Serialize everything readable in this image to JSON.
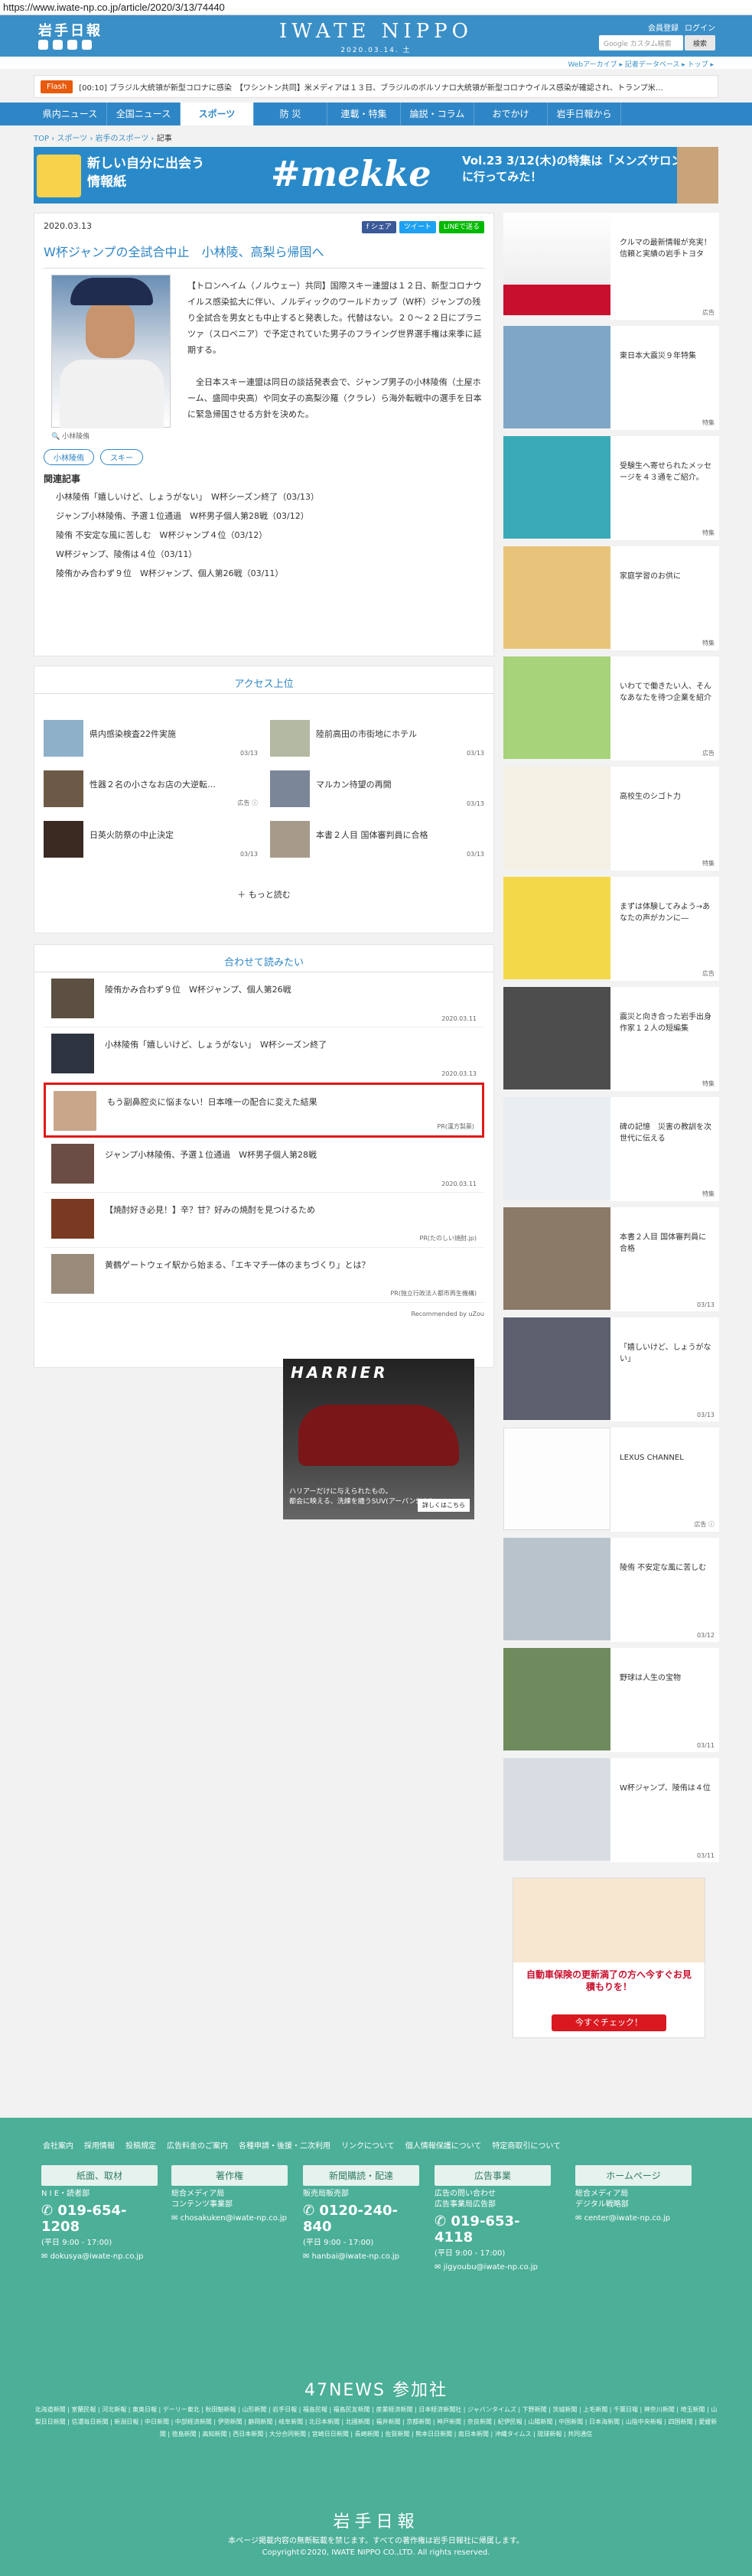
{
  "url": "https://www.iwate-np.co.jp/article/2020/3/13/74440",
  "header": {
    "logo": "岩手日報",
    "brand": "IWATE NIPPO",
    "date": "2020.03.14. 土",
    "links": [
      "会員登録",
      "ログイン"
    ],
    "search_placeholder": "Google カスタム検索",
    "search_btn": "検索",
    "sublinks": "Webアーカイブ ▸  記者データベース ▸  トップ ▸"
  },
  "flash": {
    "tag": "Flash",
    "text": "[00:10] ブラジル大統領が新型コロナに感染　【ワシントン共同】米メディアは１３日、ブラジルのボルソナロ大統領が新型コロナウイルス感染が確認され、トランプ米…"
  },
  "nav": [
    "県内ニュース",
    "全国ニュース",
    "スポーツ",
    "防 災",
    "連載・特集",
    "論説・コラム",
    "おでかけ",
    "岩手日報から"
  ],
  "crumb": [
    "TOP",
    "スポーツ",
    "岩手のスポーツ",
    "記事"
  ],
  "banner": {
    "b1": "新しい自分に出会う\n情報紙",
    "b2": "#mekke",
    "b3": "Vol.23 3/12(木)の特集は「メンズサロン」に行ってみた！"
  },
  "article": {
    "date": "2020.03.13",
    "share": [
      "f シェア",
      "ツイート",
      "LINEで送る"
    ],
    "title": "W杯ジャンプの全試合中止　小林陵、高梨ら帰国へ",
    "caption": "小林陵侑",
    "body": "【トロンヘイム（ノルウェー）共同】国際スキー連盟は１２日、新型コロナウイルス感染拡大に伴い、ノルディックのワールドカップ（W杯）ジャンプの残り全試合を男女とも中止すると発表した。代替はない。２０～２２日にプラニツァ（スロベニア）で予定されていた男子のフライング世界選手権は来季に延期する。\n\n　全日本スキー連盟は同日の談話発表会で、ジャンプ男子の小林陵侑（土屋ホーム、盛岡中央高）や同女子の高梨沙羅（クラレ）ら海外転戦中の選手を日本に緊急帰国させる方針を決めた。",
    "tags": [
      "小林陵侑",
      "スキー"
    ],
    "related_h": "関連記事",
    "related": [
      "小林陵侑「嬉しいけど、しょうがない」　W杯シーズン終了（03/13）",
      "ジャンプ小林陵侑、予選１位通過　W杯男子個人第28戦（03/12）",
      "陵侑 不安定な風に苦しむ　W杯ジャンプ４位（03/12）",
      "W杯ジャンプ、陵侑は４位（03/11）",
      "陵侑かみ合わず９位　W杯ジャンプ、個人第26戦（03/11）"
    ]
  },
  "access": {
    "title": "アクセス上位",
    "items": [
      {
        "t": "県内感染検査22件実施",
        "d": "03/13"
      },
      {
        "t": "陸前高田の市街地にホテル",
        "d": "03/13"
      },
      {
        "t": "性器２名の小さなお店の大逆転…",
        "d": "広告 ⓘ"
      },
      {
        "t": "マルカン待望の再開",
        "d": "03/13"
      },
      {
        "t": "日英火防祭の中止決定",
        "d": "03/13"
      },
      {
        "t": "本書２人目 国体審判員に合格",
        "d": "03/13"
      }
    ],
    "more": "もっと読む"
  },
  "reco": {
    "title": "合わせて読みたい",
    "items": [
      {
        "t": "陵侑かみ合わず９位　W杯ジャンプ、個人第26戦",
        "s": "2020.03.11"
      },
      {
        "t": "小林陵侑「嬉しいけど、しょうがない」　W杯シーズン終了",
        "s": "2020.03.13"
      },
      {
        "t": "もう副鼻腔炎に悩まない！日本唯一の配合に変えた結果",
        "s": "PR(漢方製薬)"
      },
      {
        "t": "ジャンプ小林陵侑、予選１位通過　W杯男子個人第28戦",
        "s": "2020.03.11"
      },
      {
        "t": "【焼酎好き必見！】辛？甘？好みの焼酎を見つけるため",
        "s": "PR(たのしい焼酎.jp)"
      },
      {
        "t": "黄鶴ゲートウェイ駅から始まる、「エキマチ一体のまちづくり」とは？",
        "s": "PR(独立行政法人都市再生機構)"
      }
    ],
    "powered": "Recommended by uZou"
  },
  "harrier": {
    "t": "HARRIER",
    "s": "ハリアーだけに与えられたもの。\n都会に映える、洗練を纏うSUV(アーバンSUV)",
    "b": "詳しくはこちら"
  },
  "side": [
    {
      "t": "クルマの最新情報が充実！信頼と実績の岩手トヨタ",
      "s": "広告"
    },
    {
      "t": "東日本大震災９年特集",
      "s": "特集"
    },
    {
      "t": "受験生へ寄せられたメッセージを４３通をご紹介。",
      "s": "特集"
    },
    {
      "t": "家庭学習のお供に",
      "s": "特集"
    },
    {
      "t": "いわてで働きたい人、そんなあなたを待つ企業を紹介",
      "s": "広告"
    },
    {
      "t": "高校生のシゴト力",
      "s": "特集"
    },
    {
      "t": "まずは体験してみよう→あなたの声がカンに―",
      "s": "広告"
    },
    {
      "t": "震災と向き合った岩手出身作家１２人の短編集",
      "s": "特集"
    },
    {
      "t": "碑の記憶　災害の教訓を次世代に伝える",
      "s": "特集"
    },
    {
      "t": "本書２人目 国体審判員に合格",
      "s": "03/13"
    },
    {
      "t": "「嬉しいけど、しょうがない」",
      "s": "03/13"
    },
    {
      "t": "LEXUS CHANNEL",
      "s": "広告 ⓘ"
    },
    {
      "t": "陵侑 不安定な風に苦しむ",
      "s": "03/12"
    },
    {
      "t": "野球は人生の宝物",
      "s": "03/11"
    },
    {
      "t": "W杯ジャンプ、陵侑は４位",
      "s": "03/11"
    }
  ],
  "bottom_ad": {
    "t": "自動車保険の更新満了の方へ今すぐお見積もりを！",
    "b": "今すぐチェック！"
  },
  "footer": {
    "nav": [
      "会社案内",
      "採用情報",
      "投稿規定",
      "広告料金のご案内",
      "各種申請・後援・二次利用",
      "リンクについて",
      "個人情報保護について",
      "特定商取引について"
    ],
    "boxes": [
      {
        "h": "紙面、取材",
        "l": "N I E・読者部",
        "tel": "019-654-1208",
        "hours": "(平日 9:00 - 17:00)",
        "mail": "dokusya@iwate-np.co.jp"
      },
      {
        "h": "著作権",
        "l": "総合メディア局\nコンテンツ事業部",
        "tel": "",
        "hours": "",
        "mail": "chosakuken@iwate-np.co.jp"
      },
      {
        "h": "新聞購読・配達",
        "l": "販売局販売部",
        "tel": "0120-240-840",
        "hours": "(平日 9:00 - 17:00)",
        "mail": "hanbai@iwate-np.co.jp"
      },
      {
        "h": "広告事業",
        "l": "広告の問い合わせ\n広告事業局広告部",
        "tel": "019-653-4118",
        "hours": "(平日 9:00 - 17:00)",
        "mail": "jigyoubu@iwate-np.co.jp"
      },
      {
        "h": "ホームページ",
        "l": "総合メディア局\nデジタル戦略部",
        "tel": "",
        "hours": "",
        "mail": "center@iwate-np.co.jp"
      }
    ],
    "news47": "47NEWS 参加社",
    "papers": "北海道新聞 | 室蘭民報 | 河北新報 | 東奥日報 | デーリー東北 | 秋田魁新報 | 山形新聞 | 岩手日報 | 福島民報 | 福島民友新聞 | 産業経済新聞 | 日本経済新聞社 | ジャパンタイムズ | 下野新聞 | 茨城新聞 | 上毛新聞 | 千葉日報 | 神奈川新聞 | 埼玉新聞 | 山梨日日新聞 | 信濃毎日新聞 | 新潟日報 | 中日新聞 | 中部経済新聞 | 伊勢新聞 | 静岡新聞 | 岐阜新聞 | 北日本新聞 | 北國新聞 | 福井新聞 | 京都新聞 | 神戸新聞 | 奈良新聞 | 紀伊民報 | 山陽新聞 | 中国新聞 | 日本海新聞 | 山陰中央新報 | 四国新聞 | 愛媛新聞 | 徳島新聞 | 高知新聞 | 西日本新聞 | 大分合同新聞 | 宮崎日日新聞 | 長崎新聞 | 佐賀新聞 | 熊本日日新聞 | 南日本新聞 | 沖縄タイムス | 琉球新報 | 共同通信",
    "logo": "岩手日報",
    "copy": "本ページ掲載内容の無断転載を禁じます。すべての著作権は岩手日報社に帰属します。\nCopyright©2020, IWATE NIPPO CO.,LTD. All rights reserved."
  }
}
